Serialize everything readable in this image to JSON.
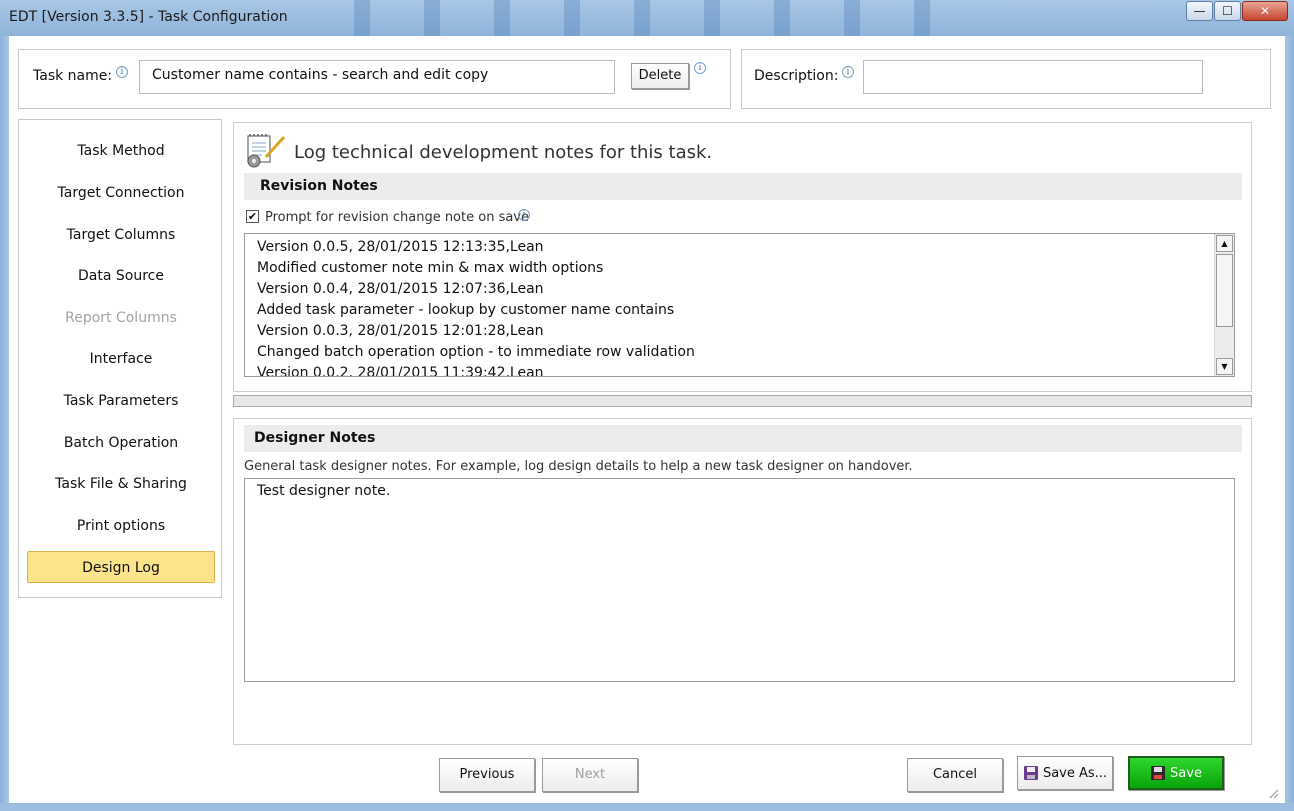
{
  "window": {
    "title": "EDT [Version 3.3.5] - Task Configuration",
    "minimize_glyph": "—",
    "maximize_glyph": "☐",
    "close_glyph": "✕"
  },
  "header": {
    "task_name_label": "Task name:",
    "task_name_value": "Customer name contains - search and edit copy",
    "delete_label": "Delete",
    "description_label": "Description:",
    "description_value": "",
    "info_glyph": "i"
  },
  "sidebar": {
    "items": [
      {
        "label": "Task Method",
        "state": "normal"
      },
      {
        "label": "Target Connection",
        "state": "normal"
      },
      {
        "label": "Target Columns",
        "state": "normal"
      },
      {
        "label": "Data Source",
        "state": "normal"
      },
      {
        "label": "Report Columns",
        "state": "disabled"
      },
      {
        "label": "Interface",
        "state": "normal"
      },
      {
        "label": "Task Parameters",
        "state": "normal"
      },
      {
        "label": "Batch Operation",
        "state": "normal"
      },
      {
        "label": "Task File & Sharing",
        "state": "normal"
      },
      {
        "label": "Print options",
        "state": "normal"
      },
      {
        "label": "Design Log",
        "state": "active"
      }
    ]
  },
  "revision": {
    "heading": "Log technical development notes for this task.",
    "section_title": "Revision Notes",
    "prompt_label": "Prompt for revision change note on save",
    "prompt_checked": true,
    "check_glyph": "✔",
    "lines": [
      "Version 0.0.5, 28/01/2015 12:13:35,Lean",
      "Modified customer note min & max width options",
      "Version 0.0.4, 28/01/2015 12:07:36,Lean",
      "Added task parameter - lookup by customer name contains",
      "Version 0.0.3, 28/01/2015 12:01:28,Lean",
      "Changed batch operation option - to immediate row validation",
      "Version 0.0.2, 28/01/2015 11:39:42,Lean"
    ],
    "scroll_up_glyph": "▲",
    "scroll_down_glyph": "▼"
  },
  "designer": {
    "section_title": "Designer Notes",
    "hint": "General task designer notes.   For example, log design details to help a new task designer on handover.",
    "value": "Test designer note."
  },
  "footer": {
    "previous_label": "Previous",
    "next_label": "Next",
    "cancel_label": "Cancel",
    "save_as_label": "Save As...",
    "save_label": "Save"
  },
  "colors": {
    "active_nav": "#fde38a",
    "save_button": "#16b816",
    "titlebar": "#9dbde0"
  }
}
